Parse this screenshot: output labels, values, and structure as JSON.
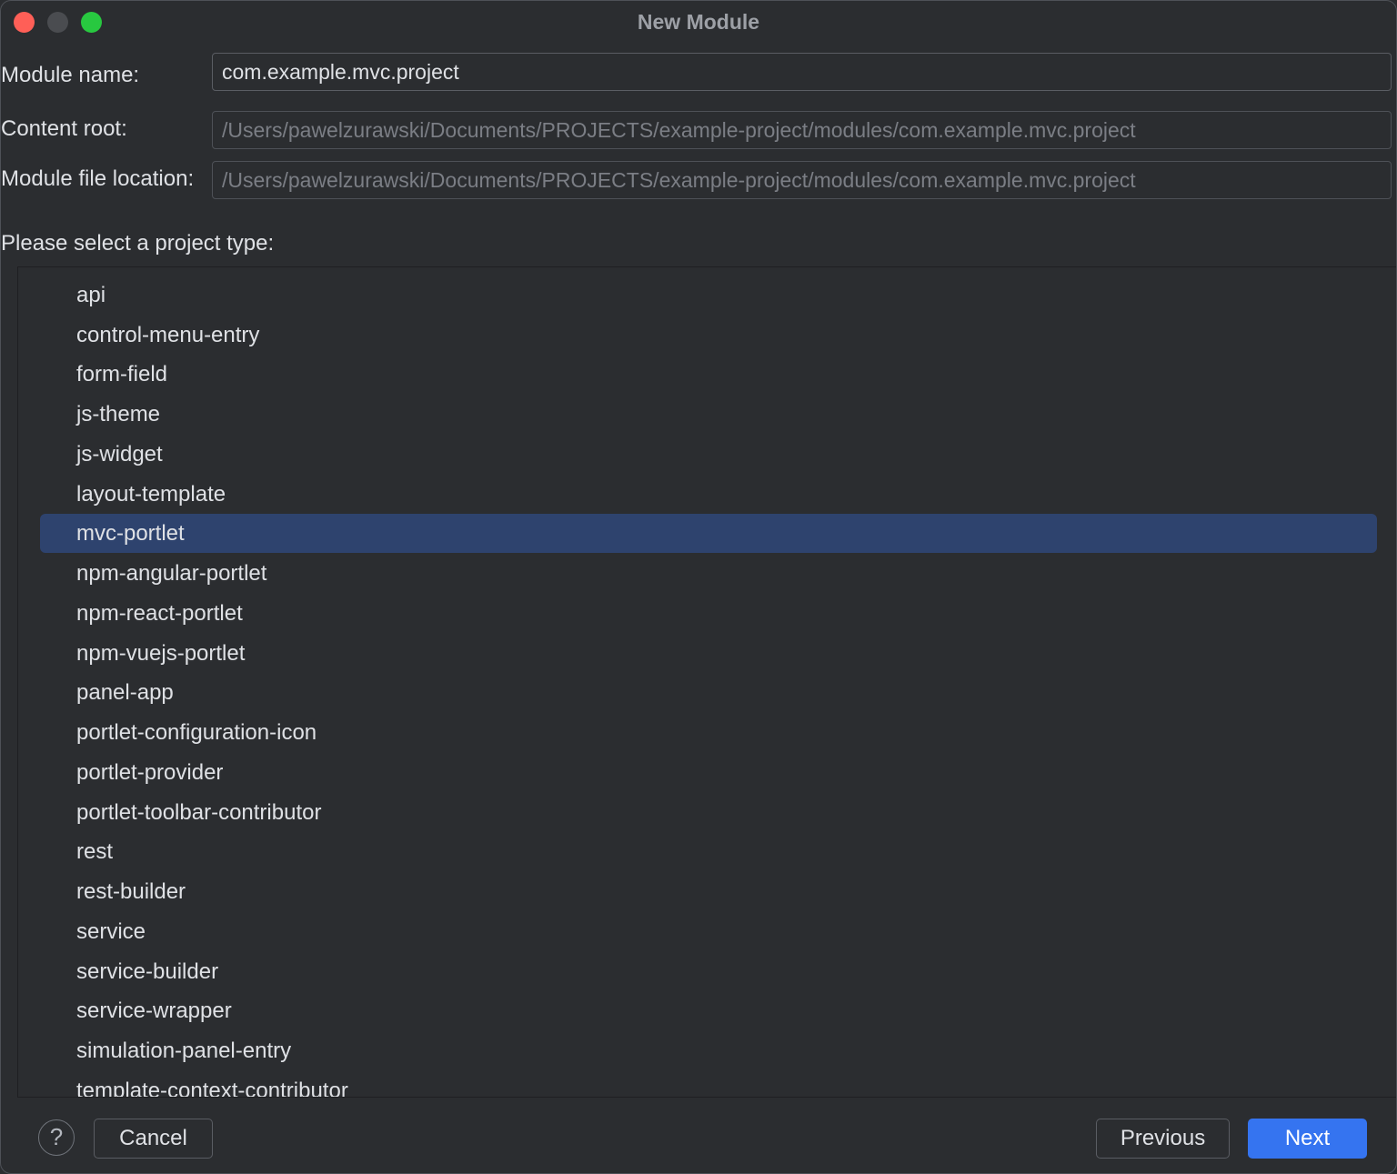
{
  "window": {
    "title": "New Module",
    "traffic_light_colors": {
      "close": "#ff5f57",
      "minimize": "#4a4c50",
      "maximize": "#28c840"
    }
  },
  "form": {
    "module_name": {
      "label": "Module name:",
      "value": "com.example.mvc.project"
    },
    "content_root": {
      "label": "Content root:",
      "value": "/Users/pawelzurawski/Documents/PROJECTS/example-project/modules/com.example.mvc.project"
    },
    "module_file_location": {
      "label": "Module file location:",
      "value": "/Users/pawelzurawski/Documents/PROJECTS/example-project/modules/com.example.mvc.project"
    }
  },
  "project_types": {
    "prompt": "Please select a project type:",
    "selected": "mvc-portlet",
    "items": [
      "api",
      "control-menu-entry",
      "form-field",
      "js-theme",
      "js-widget",
      "layout-template",
      "mvc-portlet",
      "npm-angular-portlet",
      "npm-react-portlet",
      "npm-vuejs-portlet",
      "panel-app",
      "portlet-configuration-icon",
      "portlet-provider",
      "portlet-toolbar-contributor",
      "rest",
      "rest-builder",
      "service",
      "service-builder",
      "service-wrapper",
      "simulation-panel-entry",
      "template-context-contributor"
    ]
  },
  "footer": {
    "help_label": "?",
    "cancel_label": "Cancel",
    "previous_label": "Previous",
    "next_label": "Next"
  },
  "colors": {
    "background": "#2b2d30",
    "selection": "#2e436e",
    "primary_button": "#3574f0",
    "text": "#dfe1e5",
    "muted_text": "#7b7e85"
  }
}
